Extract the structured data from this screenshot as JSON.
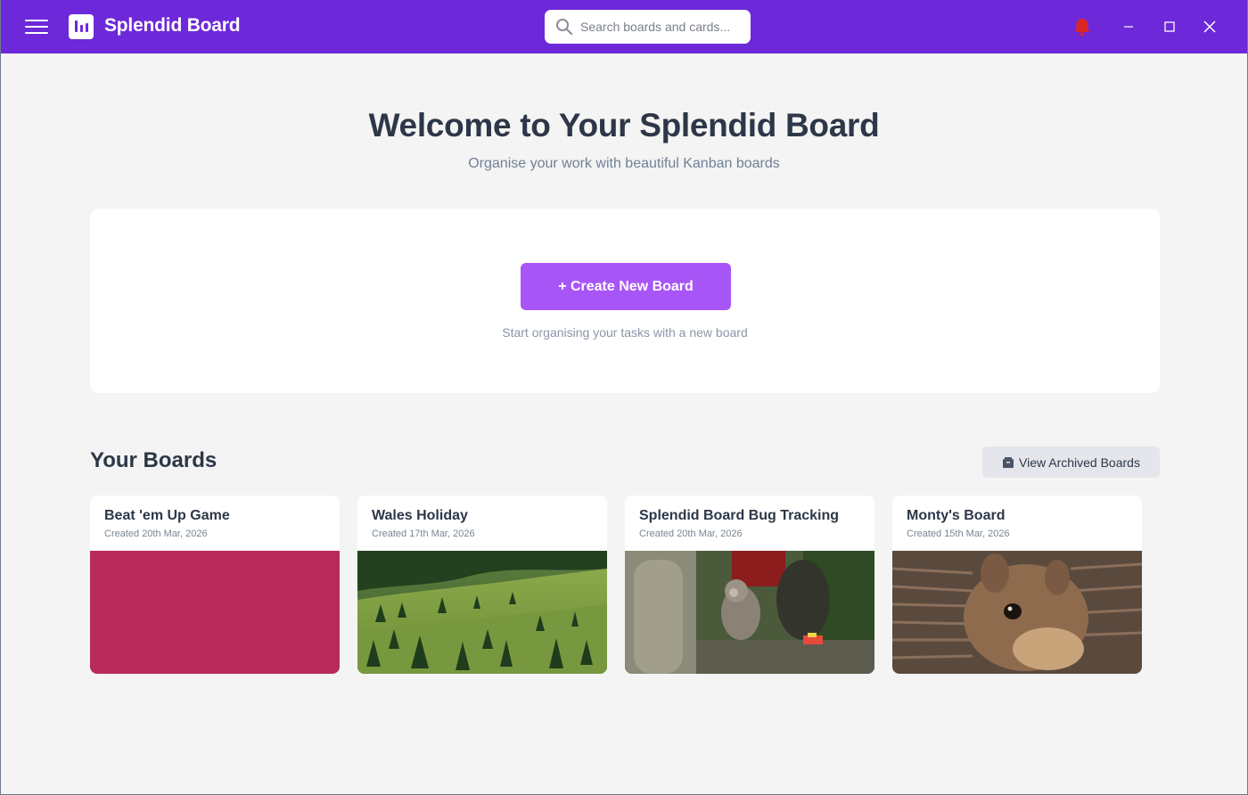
{
  "app": {
    "title": "Splendid Board",
    "accent_color": "#6d28d9"
  },
  "titlebar": {
    "menu_icon": "hamburger-menu-icon",
    "logo_icon": "bar-chart-icon",
    "search": {
      "placeholder": "Search boards and cards...",
      "value": "",
      "icon": "search-icon"
    },
    "notification_icon": "bell-icon",
    "notification_color": "#dc2626",
    "window_controls": [
      "minimize-icon",
      "maximize-icon",
      "close-icon"
    ]
  },
  "hero": {
    "title": "Welcome to Your Splendid Board",
    "subtitle": "Organise your work with beautiful Kanban boards"
  },
  "create": {
    "button_label": "+ Create New Board",
    "hint": "Start organising your tasks with a new board",
    "button_color": "#a855f7"
  },
  "boards_section": {
    "title": "Your Boards",
    "archived_button_label": "View Archived Boards",
    "archived_icon": "file-cabinet-icon",
    "boards": [
      {
        "name": "Beat 'em Up Game",
        "created": "Created 20th Mar, 2026",
        "thumbnail": "solid-color",
        "color": "#b82a5a"
      },
      {
        "name": "Wales Holiday",
        "created": "Created 17th Mar, 2026",
        "thumbnail": "mountain-meadow-photo"
      },
      {
        "name": "Splendid Board Bug Tracking",
        "created": "Created 20th Mar, 2026",
        "thumbnail": "monkey-temple-photo"
      },
      {
        "name": "Monty's Board",
        "created": "Created 15th Mar, 2026",
        "thumbnail": "squirrel-photo"
      }
    ]
  }
}
